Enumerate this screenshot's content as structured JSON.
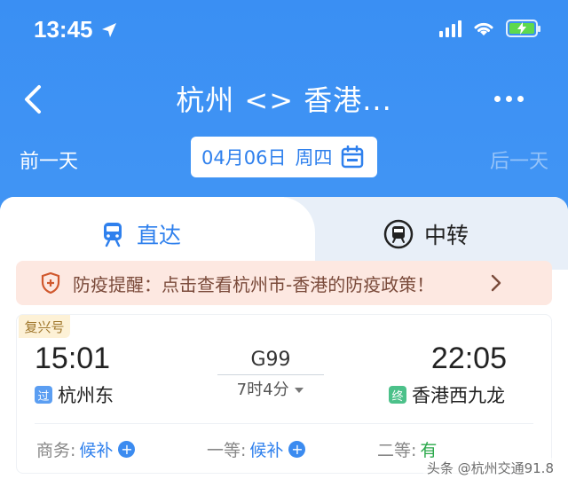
{
  "status_bar": {
    "time": "13:45"
  },
  "nav": {
    "title": "杭州 <> 香港..."
  },
  "date_row": {
    "prev_label": "前一天",
    "date": "04月06日",
    "weekday": "周四",
    "next_label": "后一天"
  },
  "tabs": [
    {
      "label": "直达",
      "active": true
    },
    {
      "label": "中转",
      "active": false
    }
  ],
  "notice": {
    "text": "防疫提醒：点击查看杭州市-香港的防疫政策！"
  },
  "train": {
    "badge": "复兴号",
    "departure_time": "15:01",
    "arrival_time": "22:05",
    "train_number": "G99",
    "duration": "7时4分",
    "from_tag": "过",
    "from_station": "杭州东",
    "to_tag": "终",
    "to_station": "香港西九龙",
    "seats": [
      {
        "class": "商务:",
        "status": "候补"
      },
      {
        "class": "一等:",
        "status": "候补"
      },
      {
        "class": "二等:",
        "status": "有"
      }
    ]
  },
  "watermark": "头条 @杭州交通91.8",
  "colors": {
    "primary": "#2f80ed",
    "header_bg": "#3a8ff3",
    "available": "#2aa84a"
  }
}
